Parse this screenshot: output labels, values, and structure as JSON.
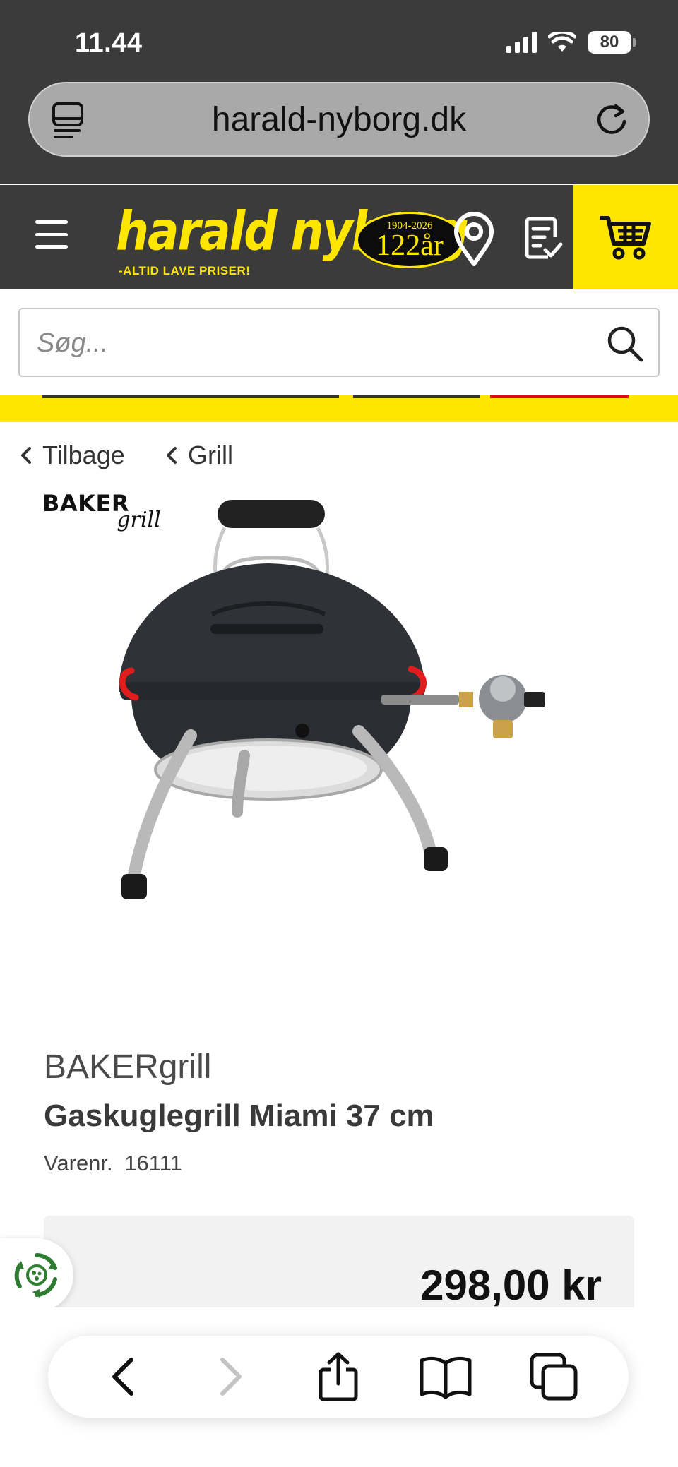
{
  "status_bar": {
    "time": "11.44",
    "battery": "80"
  },
  "browser": {
    "url": "harald-nyborg.dk"
  },
  "header": {
    "logo_name": "harald nyborg",
    "logo_tagline": "-ALTID LAVE PRISER!",
    "anniversary_years": "1904-2026",
    "anniversary_number": "122år",
    "icons": [
      "menu-icon",
      "location-pin-icon",
      "checklist-icon",
      "cart-icon"
    ],
    "accent_color": "#ffe600",
    "dark_color": "#3b3b3b"
  },
  "search": {
    "placeholder": "Søg..."
  },
  "breadcrumb": {
    "back_label": "Tilbage",
    "category_label": "Grill"
  },
  "product": {
    "brand_logo_text": "BAKER",
    "brand_logo_script": "grill",
    "brand": "BAKERgrill",
    "title": "Gaskuglegrill Miami 37 cm",
    "sku_label": "Varenr.",
    "sku_value": "16111",
    "price": "298,00 kr"
  },
  "toolbar": {
    "icons": [
      "back-icon",
      "forward-icon",
      "share-icon",
      "bookmarks-icon",
      "tabs-icon"
    ]
  }
}
